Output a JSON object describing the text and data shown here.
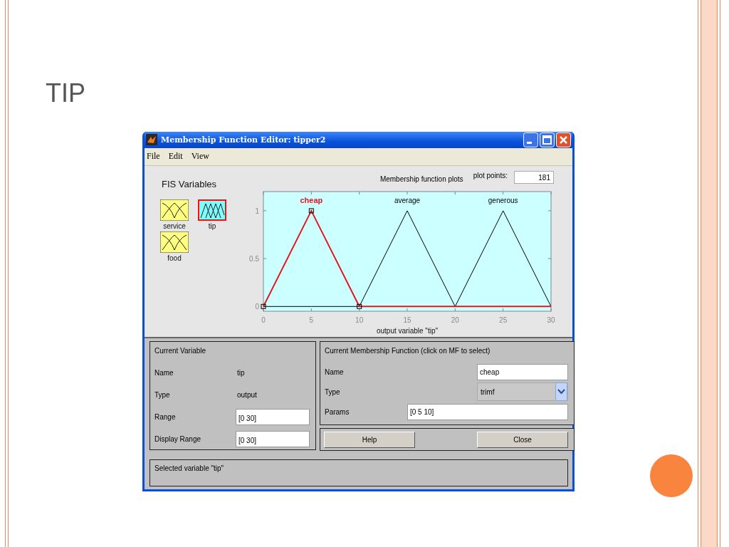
{
  "slide": {
    "title": "TIP"
  },
  "window": {
    "title": "Membership Function Editor: tipper2"
  },
  "menu": [
    "File",
    "Edit",
    "View"
  ],
  "fis_variables": {
    "heading": "FIS Variables",
    "items": [
      {
        "label": "service",
        "kind": "input",
        "selected": false
      },
      {
        "label": "tip",
        "kind": "output",
        "selected": true
      },
      {
        "label": "food",
        "kind": "input",
        "selected": false
      }
    ]
  },
  "plot": {
    "title": "Membership function plots",
    "plot_points_label": "plot points:",
    "plot_points": "181",
    "chart_data": {
      "type": "line",
      "xlabel": "output variable \"tip\"",
      "x": [
        0,
        5,
        10,
        15,
        20,
        25,
        30
      ],
      "xlim": [
        0,
        30
      ],
      "ylim": [
        -0.05,
        1.2
      ],
      "xticks": [
        0,
        5,
        10,
        15,
        20,
        25,
        30
      ],
      "yticks": [
        0,
        0.5,
        1
      ],
      "series": [
        {
          "name": "cheap",
          "color": "#e8141e",
          "values": [
            0,
            1,
            0,
            0,
            0,
            0,
            0
          ]
        },
        {
          "name": "average",
          "color": "#000000",
          "values": [
            0,
            0,
            0,
            1,
            0,
            null,
            null
          ]
        },
        {
          "name": "generous",
          "color": "#000000",
          "values": [
            null,
            null,
            null,
            null,
            0,
            1,
            0
          ]
        }
      ]
    },
    "curves": [
      {
        "selected": true
      },
      {
        "selected": false
      },
      {
        "selected": false
      }
    ]
  },
  "current_variable": {
    "heading": "Current Variable",
    "name_label": "Name",
    "name": "tip",
    "type_label": "Type",
    "type": "output",
    "range_label": "Range",
    "range": "[0 30]",
    "display_range_label": "Display Range",
    "display_range": "[0 30]"
  },
  "current_mf": {
    "heading": "Current Membership Function (click on MF to select)",
    "name_label": "Name",
    "name": "cheap",
    "type_label": "Type",
    "type": "trimf",
    "params_label": "Params",
    "params": "[0 5 10]"
  },
  "buttons": [
    "Help",
    "Close"
  ],
  "status": "Selected variable \"tip\""
}
